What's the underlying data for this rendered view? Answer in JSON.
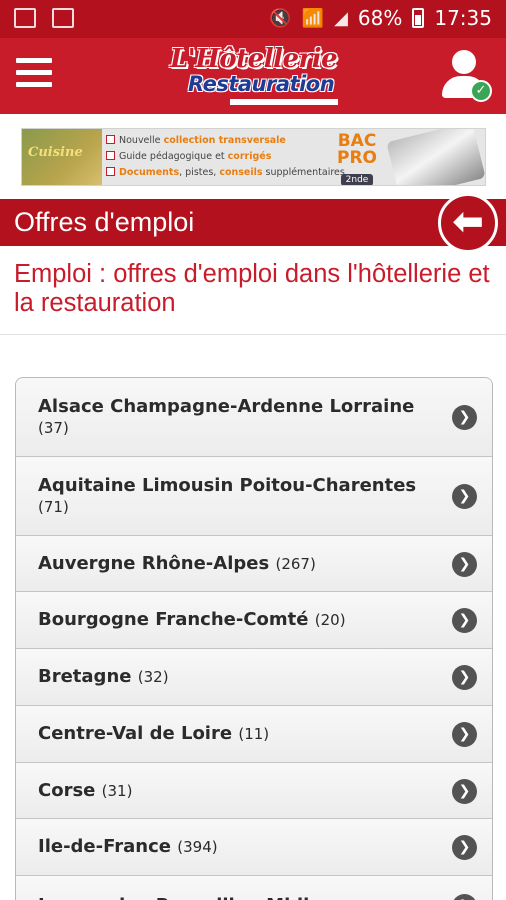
{
  "status_bar": {
    "battery": "68%",
    "time": "17:35"
  },
  "app_bar": {
    "logo_line1": "L'Hôtellerie",
    "logo_line2": "Restauration"
  },
  "banner": {
    "book_title": "Cuisine",
    "line1_prefix": "Nouvelle ",
    "line1_highlight": "collection transversale",
    "line2_prefix": "Guide pédagogique et ",
    "line2_highlight": "corrigés",
    "line3_highlight": "Documents",
    "line3_mid": ", pistes, ",
    "line3_highlight2": "conseils",
    "line3_suffix": " supplémentaires",
    "bac": "BAC",
    "pro": "PRO",
    "badge": "2nde"
  },
  "section": {
    "title": "Offres d'emploi"
  },
  "page": {
    "heading": "Emploi : offres d'emploi dans l'hôtellerie et la restauration"
  },
  "regions": [
    {
      "name": "Alsace Champagne-Ardenne Lorraine",
      "count": "(37)"
    },
    {
      "name": "Aquitaine Limousin Poitou-Charentes",
      "count": "(71)"
    },
    {
      "name": "Auvergne Rhône-Alpes",
      "count": "(267)"
    },
    {
      "name": "Bourgogne Franche-Comté",
      "count": "(20)"
    },
    {
      "name": "Bretagne",
      "count": "(32)"
    },
    {
      "name": "Centre-Val de Loire",
      "count": "(11)"
    },
    {
      "name": "Corse",
      "count": "(31)"
    },
    {
      "name": "Ile-de-France",
      "count": "(394)"
    },
    {
      "name": "Languedoc-Roussillon Midi",
      "count": ""
    }
  ],
  "icons": {
    "menu": "hamburger-menu-icon",
    "account": "user-check-icon",
    "back": "back-arrow-icon",
    "row": "chevron-right-icon"
  },
  "colors": {
    "primary_red": "#c81c2b",
    "dark_red": "#b4111f",
    "chevron_grey": "#535353",
    "check_green": "#3aa655"
  }
}
